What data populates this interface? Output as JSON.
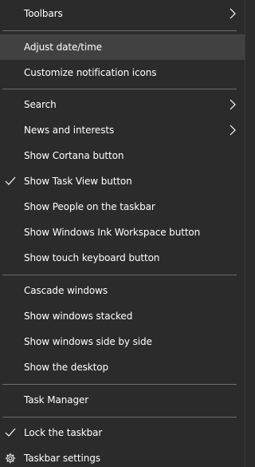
{
  "menu": {
    "items": {
      "toolbars": {
        "label": "Toolbars",
        "icon": "chevron-right-icon"
      },
      "adjust_datetime": {
        "label": "Adjust date/time",
        "highlighted": true
      },
      "customize_notification_icons": {
        "label": "Customize notification icons"
      },
      "search": {
        "label": "Search",
        "icon": "chevron-right-icon"
      },
      "news_and_interests": {
        "label": "News and interests",
        "icon": "chevron-right-icon"
      },
      "show_cortana_button": {
        "label": "Show Cortana button"
      },
      "show_task_view_button": {
        "label": "Show Task View button",
        "checked": true
      },
      "show_people": {
        "label": "Show People on the taskbar"
      },
      "show_ink_workspace": {
        "label": "Show Windows Ink Workspace button"
      },
      "show_touch_keyboard": {
        "label": "Show touch keyboard button"
      },
      "cascade_windows": {
        "label": "Cascade windows"
      },
      "show_windows_stacked": {
        "label": "Show windows stacked"
      },
      "show_windows_side_by_side": {
        "label": "Show windows side by side"
      },
      "show_the_desktop": {
        "label": "Show the desktop"
      },
      "task_manager": {
        "label": "Task Manager"
      },
      "lock_the_taskbar": {
        "label": "Lock the taskbar",
        "checked": true
      },
      "taskbar_settings": {
        "label": "Taskbar settings",
        "icon": "gear-icon"
      }
    }
  },
  "colors": {
    "background": "#2b2b2b",
    "highlight": "#414141",
    "separator": "#6b6b6b",
    "text": "#ffffff"
  }
}
